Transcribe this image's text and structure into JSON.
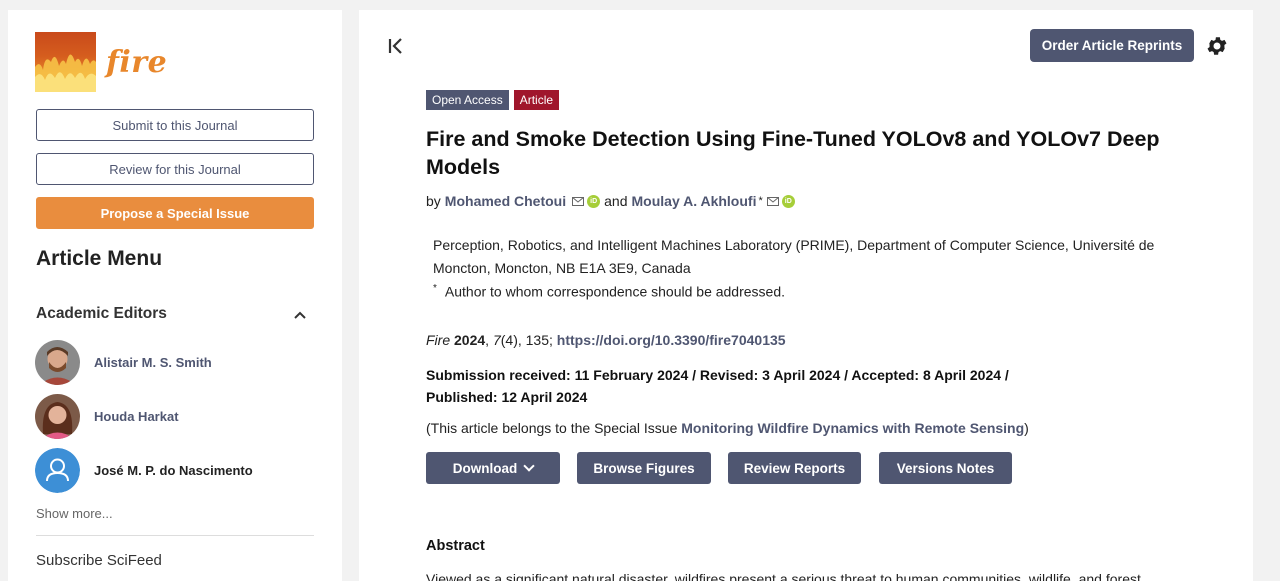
{
  "journal": {
    "name": "fire"
  },
  "sidebar": {
    "submit_label": "Submit to this Journal",
    "review_label": "Review for this Journal",
    "propose_label": "Propose a Special Issue",
    "menu_title": "Article Menu",
    "editors_title": "Academic Editors",
    "editors": [
      {
        "name": "Alistair M. S. Smith"
      },
      {
        "name": "Houda Harkat"
      },
      {
        "name": "José M. P. do Nascimento"
      }
    ],
    "show_more": "Show more...",
    "subscribe": "Subscribe SciFeed"
  },
  "toolbar": {
    "order_reprints": "Order Article Reprints"
  },
  "article": {
    "badge_open_access": "Open Access",
    "badge_type": "Article",
    "title": "Fire and Smoke Detection Using Fine-Tuned YOLOv8 and YOLOv7 Deep Models",
    "by": "by",
    "and": "and",
    "author1": "Mohamed Chetoui",
    "author2": "Moulay A. Akhloufi",
    "author2_mark": "*",
    "affiliation": "Perception, Robotics, and Intelligent Machines Laboratory (PRIME), Department of Computer Science, Université de Moncton, Moncton, NB E1A 3E9, Canada",
    "corr_mark": "*",
    "corr_text": "Author to whom correspondence should be addressed.",
    "cite_journal": "Fire",
    "cite_year": "2024",
    "cite_volume": "7",
    "cite_rest": "(4), 135;",
    "doi": "https://doi.org/10.3390/fire7040135",
    "dates": "Submission received: 11 February 2024 / Revised: 3 April 2024 / Accepted: 8 April 2024 / Published: 12 April 2024",
    "special_prefix": "(This article belongs to the Special Issue",
    "special_link": "Monitoring Wildfire Dynamics with Remote Sensing",
    "special_suffix": ")",
    "abstract_heading": "Abstract",
    "abstract_text": "Viewed as a significant natural disaster, wildfires present a serious threat to human communities, wildlife, and forest"
  },
  "actions": {
    "download": "Download",
    "browse_figures": "Browse Figures",
    "review_reports": "Review Reports",
    "versions_notes": "Versions Notes"
  },
  "colors": {
    "primary": "#4f5671",
    "accent_orange": "#e98d3e",
    "badge_article": "#a0162c",
    "orcid": "#a6ce39"
  }
}
